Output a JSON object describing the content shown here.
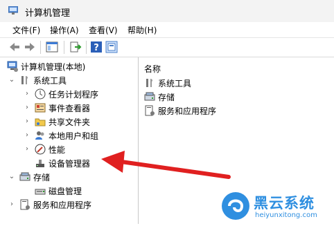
{
  "window": {
    "title": "计算机管理"
  },
  "menu": [
    {
      "label": "文件(F)"
    },
    {
      "label": "操作(A)"
    },
    {
      "label": "查看(V)"
    },
    {
      "label": "帮助(H)"
    }
  ],
  "toolbar": {
    "icons": [
      "back-icon",
      "forward-icon",
      "show-hide-console-tree-icon",
      "export-list-icon",
      "help-icon",
      "properties-icon"
    ]
  },
  "tree": {
    "root": "计算机管理(本地)",
    "system_tools": "系统工具",
    "children": [
      {
        "label": "任务计划程序",
        "icon": "clock-icon"
      },
      {
        "label": "事件查看器",
        "icon": "event-viewer-icon"
      },
      {
        "label": "共享文件夹",
        "icon": "shared-folder-icon"
      },
      {
        "label": "本地用户和组",
        "icon": "users-icon"
      },
      {
        "label": "性能",
        "icon": "performance-icon"
      },
      {
        "label": "设备管理器",
        "icon": "device-manager-icon"
      }
    ],
    "storage": "存储",
    "disk": "磁盘管理",
    "services": "服务和应用程序"
  },
  "list": {
    "header": "名称",
    "items": [
      {
        "label": "系统工具",
        "icon": "tools-icon"
      },
      {
        "label": "存储",
        "icon": "storage-icon"
      },
      {
        "label": "服务和应用程序",
        "icon": "services-icon"
      }
    ]
  },
  "watermark": {
    "brand": "黑云系统",
    "url": "heiyunxitong.com"
  },
  "colors": {
    "arrow": "#e02020",
    "accent": "#2b6fd6",
    "watermark_blue": "#2f8fe0"
  }
}
